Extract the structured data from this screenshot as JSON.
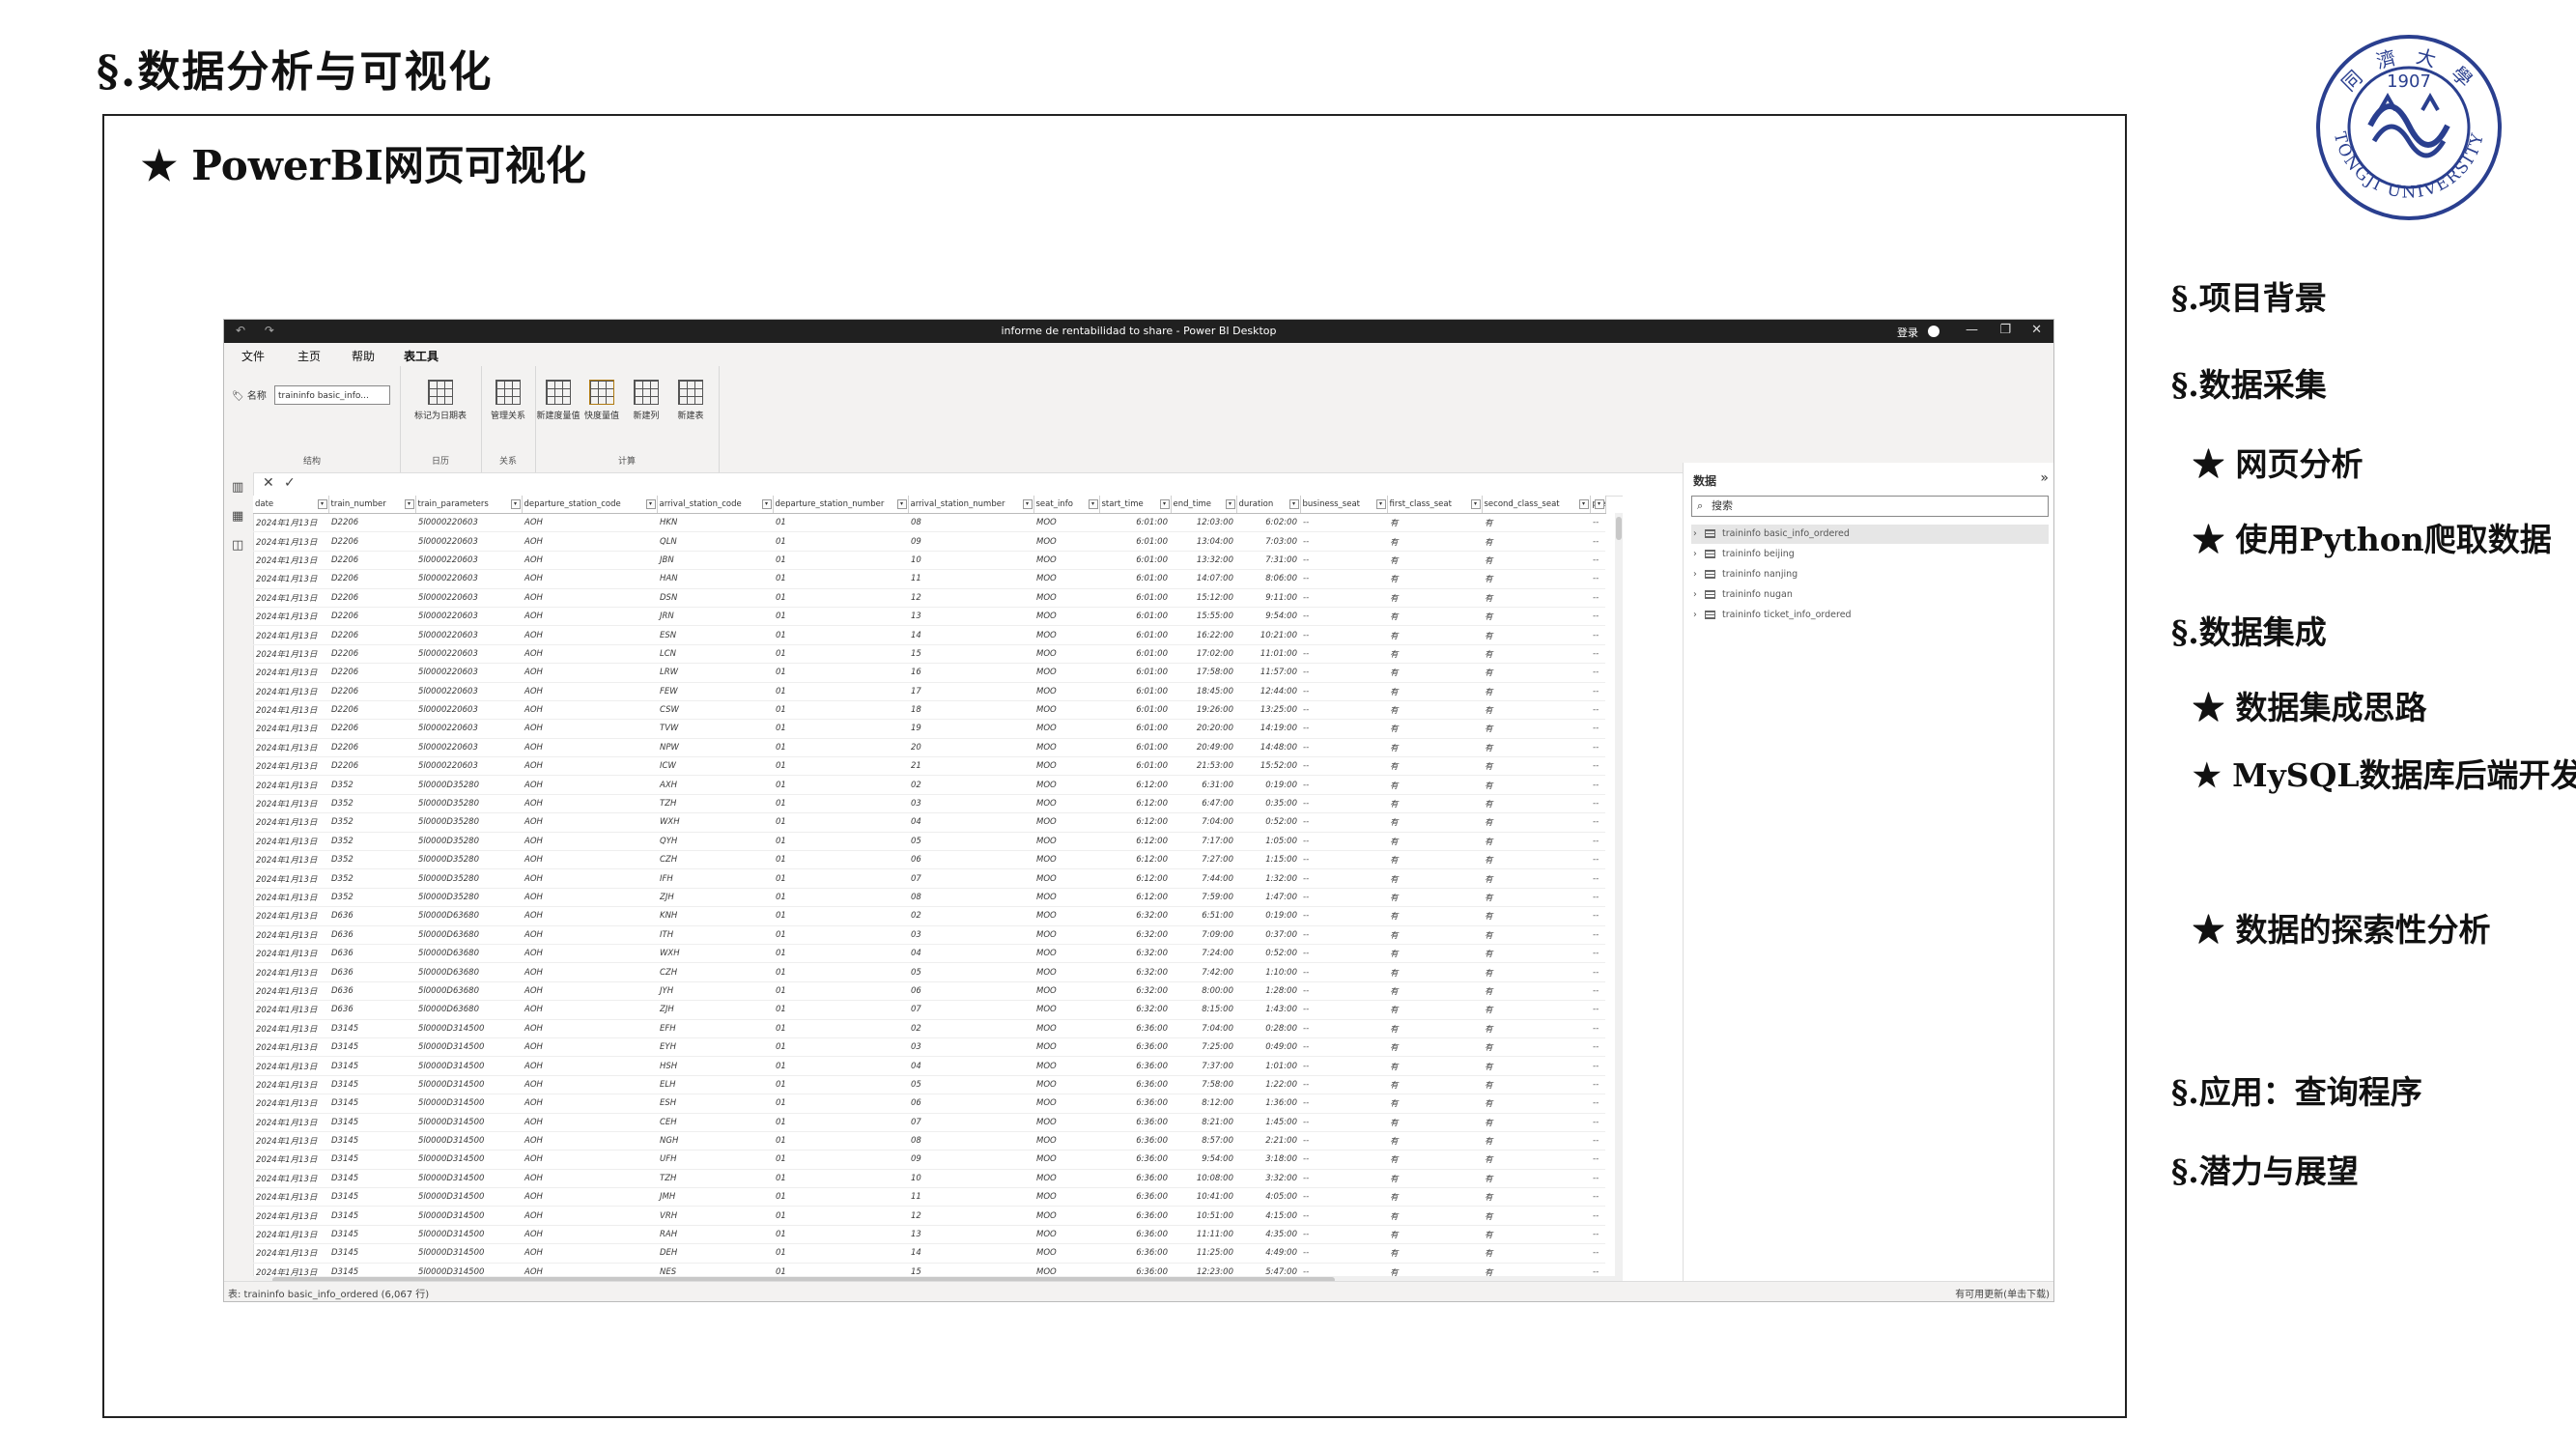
{
  "slide": {
    "title": "§.数据分析与可视化",
    "heading": "★ PowerBI网页可视化"
  },
  "nav": {
    "items": [
      {
        "label": "§.项目背景"
      },
      {
        "label": "§.数据采集"
      },
      {
        "label": "★ 网页分析"
      },
      {
        "label": "★ 使用Python爬取数据"
      },
      {
        "label": "§.数据集成"
      },
      {
        "label": "★ 数据集成思路"
      },
      {
        "label": "★ MySQL数据库后端开发"
      },
      {
        "label": "★ 数据的探索性分析"
      },
      {
        "label": "§.应用：查询程序"
      },
      {
        "label": "§.潜力与展望"
      }
    ]
  },
  "logo": {
    "year": "1907",
    "text": "TONGJI UNIVERSITY",
    "chars": "同 濟 大 學"
  },
  "powerbi": {
    "window_title": "informe de rentabilidad to share - Power BI Desktop",
    "quick_access": "↶ ↷",
    "login": "登录",
    "window_controls": {
      "min": "—",
      "max": "❐",
      "close": "✕"
    },
    "menu": [
      "文件",
      "主页",
      "帮助",
      "表工具"
    ],
    "ribbon": {
      "name_label": "名称",
      "name_value": "traininfo basic_info...",
      "group_structure": "结构",
      "mark_date_table": "标记为日期表",
      "group_calendar": "日历",
      "manage_relations": "管理关系",
      "group_relations": "关系",
      "new_measure": "新建度量值",
      "quick_measure": "快度量值",
      "new_column": "新建列",
      "new_table": "新建表",
      "group_calc": "计算"
    },
    "left_icons": [
      "bar-chart-icon",
      "table-icon",
      "model-icon"
    ],
    "formula": {
      "cancel": "✕",
      "commit": "✓"
    },
    "columns": [
      "date",
      "train_number",
      "train_parameters",
      "departure_station_code",
      "arrival_station_code",
      "departure_station_number",
      "arrival_station_number",
      "seat_info",
      "start_time",
      "end_time",
      "duration",
      "business_seat",
      "first_class_seat",
      "second_class_seat",
      "premiu"
    ],
    "rows": [
      [
        "2024年1月13日",
        "D2206",
        "5l0000220603",
        "AOH",
        "HKN",
        "01",
        "08",
        "MOO",
        "6:01:00",
        "12:03:00",
        "6:02:00",
        "--",
        "有",
        "有",
        "--"
      ],
      [
        "2024年1月13日",
        "D2206",
        "5l0000220603",
        "AOH",
        "QLN",
        "01",
        "09",
        "MOO",
        "6:01:00",
        "13:04:00",
        "7:03:00",
        "--",
        "有",
        "有",
        "--"
      ],
      [
        "2024年1月13日",
        "D2206",
        "5l0000220603",
        "AOH",
        "JBN",
        "01",
        "10",
        "MOO",
        "6:01:00",
        "13:32:00",
        "7:31:00",
        "--",
        "有",
        "有",
        "--"
      ],
      [
        "2024年1月13日",
        "D2206",
        "5l0000220603",
        "AOH",
        "HAN",
        "01",
        "11",
        "MOO",
        "6:01:00",
        "14:07:00",
        "8:06:00",
        "--",
        "有",
        "有",
        "--"
      ],
      [
        "2024年1月13日",
        "D2206",
        "5l0000220603",
        "AOH",
        "DSN",
        "01",
        "12",
        "MOO",
        "6:01:00",
        "15:12:00",
        "9:11:00",
        "--",
        "有",
        "有",
        "--"
      ],
      [
        "2024年1月13日",
        "D2206",
        "5l0000220603",
        "AOH",
        "JRN",
        "01",
        "13",
        "MOO",
        "6:01:00",
        "15:55:00",
        "9:54:00",
        "--",
        "有",
        "有",
        "--"
      ],
      [
        "2024年1月13日",
        "D2206",
        "5l0000220603",
        "AOH",
        "ESN",
        "01",
        "14",
        "MOO",
        "6:01:00",
        "16:22:00",
        "10:21:00",
        "--",
        "有",
        "有",
        "--"
      ],
      [
        "2024年1月13日",
        "D2206",
        "5l0000220603",
        "AOH",
        "LCN",
        "01",
        "15",
        "MOO",
        "6:01:00",
        "17:02:00",
        "11:01:00",
        "--",
        "有",
        "有",
        "--"
      ],
      [
        "2024年1月13日",
        "D2206",
        "5l0000220603",
        "AOH",
        "LRW",
        "01",
        "16",
        "MOO",
        "6:01:00",
        "17:58:00",
        "11:57:00",
        "--",
        "有",
        "有",
        "--"
      ],
      [
        "2024年1月13日",
        "D2206",
        "5l0000220603",
        "AOH",
        "FEW",
        "01",
        "17",
        "MOO",
        "6:01:00",
        "18:45:00",
        "12:44:00",
        "--",
        "有",
        "有",
        "--"
      ],
      [
        "2024年1月13日",
        "D2206",
        "5l0000220603",
        "AOH",
        "CSW",
        "01",
        "18",
        "MOO",
        "6:01:00",
        "19:26:00",
        "13:25:00",
        "--",
        "有",
        "有",
        "--"
      ],
      [
        "2024年1月13日",
        "D2206",
        "5l0000220603",
        "AOH",
        "TVW",
        "01",
        "19",
        "MOO",
        "6:01:00",
        "20:20:00",
        "14:19:00",
        "--",
        "有",
        "有",
        "--"
      ],
      [
        "2024年1月13日",
        "D2206",
        "5l0000220603",
        "AOH",
        "NPW",
        "01",
        "20",
        "MOO",
        "6:01:00",
        "20:49:00",
        "14:48:00",
        "--",
        "有",
        "有",
        "--"
      ],
      [
        "2024年1月13日",
        "D2206",
        "5l0000220603",
        "AOH",
        "ICW",
        "01",
        "21",
        "MOO",
        "6:01:00",
        "21:53:00",
        "15:52:00",
        "--",
        "有",
        "有",
        "--"
      ],
      [
        "2024年1月13日",
        "D352",
        "5l0000D35280",
        "AOH",
        "AXH",
        "01",
        "02",
        "MOO",
        "6:12:00",
        "6:31:00",
        "0:19:00",
        "--",
        "有",
        "有",
        "--"
      ],
      [
        "2024年1月13日",
        "D352",
        "5l0000D35280",
        "AOH",
        "TZH",
        "01",
        "03",
        "MOO",
        "6:12:00",
        "6:47:00",
        "0:35:00",
        "--",
        "有",
        "有",
        "--"
      ],
      [
        "2024年1月13日",
        "D352",
        "5l0000D35280",
        "AOH",
        "WXH",
        "01",
        "04",
        "MOO",
        "6:12:00",
        "7:04:00",
        "0:52:00",
        "--",
        "有",
        "有",
        "--"
      ],
      [
        "2024年1月13日",
        "D352",
        "5l0000D35280",
        "AOH",
        "QYH",
        "01",
        "05",
        "MOO",
        "6:12:00",
        "7:17:00",
        "1:05:00",
        "--",
        "有",
        "有",
        "--"
      ],
      [
        "2024年1月13日",
        "D352",
        "5l0000D35280",
        "AOH",
        "CZH",
        "01",
        "06",
        "MOO",
        "6:12:00",
        "7:27:00",
        "1:15:00",
        "--",
        "有",
        "有",
        "--"
      ],
      [
        "2024年1月13日",
        "D352",
        "5l0000D35280",
        "AOH",
        "IFH",
        "01",
        "07",
        "MOO",
        "6:12:00",
        "7:44:00",
        "1:32:00",
        "--",
        "有",
        "有",
        "--"
      ],
      [
        "2024年1月13日",
        "D352",
        "5l0000D35280",
        "AOH",
        "ZJH",
        "01",
        "08",
        "MOO",
        "6:12:00",
        "7:59:00",
        "1:47:00",
        "--",
        "有",
        "有",
        "--"
      ],
      [
        "2024年1月13日",
        "D636",
        "5l0000D63680",
        "AOH",
        "KNH",
        "01",
        "02",
        "MOO",
        "6:32:00",
        "6:51:00",
        "0:19:00",
        "--",
        "有",
        "有",
        "--"
      ],
      [
        "2024年1月13日",
        "D636",
        "5l0000D63680",
        "AOH",
        "ITH",
        "01",
        "03",
        "MOO",
        "6:32:00",
        "7:09:00",
        "0:37:00",
        "--",
        "有",
        "有",
        "--"
      ],
      [
        "2024年1月13日",
        "D636",
        "5l0000D63680",
        "AOH",
        "WXH",
        "01",
        "04",
        "MOO",
        "6:32:00",
        "7:24:00",
        "0:52:00",
        "--",
        "有",
        "有",
        "--"
      ],
      [
        "2024年1月13日",
        "D636",
        "5l0000D63680",
        "AOH",
        "CZH",
        "01",
        "05",
        "MOO",
        "6:32:00",
        "7:42:00",
        "1:10:00",
        "--",
        "有",
        "有",
        "--"
      ],
      [
        "2024年1月13日",
        "D636",
        "5l0000D63680",
        "AOH",
        "JYH",
        "01",
        "06",
        "MOO",
        "6:32:00",
        "8:00:00",
        "1:28:00",
        "--",
        "有",
        "有",
        "--"
      ],
      [
        "2024年1月13日",
        "D636",
        "5l0000D63680",
        "AOH",
        "ZJH",
        "01",
        "07",
        "MOO",
        "6:32:00",
        "8:15:00",
        "1:43:00",
        "--",
        "有",
        "有",
        "--"
      ],
      [
        "2024年1月13日",
        "D3145",
        "5l0000D314500",
        "AOH",
        "EFH",
        "01",
        "02",
        "MOO",
        "6:36:00",
        "7:04:00",
        "0:28:00",
        "--",
        "有",
        "有",
        "--"
      ],
      [
        "2024年1月13日",
        "D3145",
        "5l0000D314500",
        "AOH",
        "EYH",
        "01",
        "03",
        "MOO",
        "6:36:00",
        "7:25:00",
        "0:49:00",
        "--",
        "有",
        "有",
        "--"
      ],
      [
        "2024年1月13日",
        "D3145",
        "5l0000D314500",
        "AOH",
        "HSH",
        "01",
        "04",
        "MOO",
        "6:36:00",
        "7:37:00",
        "1:01:00",
        "--",
        "有",
        "有",
        "--"
      ],
      [
        "2024年1月13日",
        "D3145",
        "5l0000D314500",
        "AOH",
        "ELH",
        "01",
        "05",
        "MOO",
        "6:36:00",
        "7:58:00",
        "1:22:00",
        "--",
        "有",
        "有",
        "--"
      ],
      [
        "2024年1月13日",
        "D3145",
        "5l0000D314500",
        "AOH",
        "ESH",
        "01",
        "06",
        "MOO",
        "6:36:00",
        "8:12:00",
        "1:36:00",
        "--",
        "有",
        "有",
        "--"
      ],
      [
        "2024年1月13日",
        "D3145",
        "5l0000D314500",
        "AOH",
        "CEH",
        "01",
        "07",
        "MOO",
        "6:36:00",
        "8:21:00",
        "1:45:00",
        "--",
        "有",
        "有",
        "--"
      ],
      [
        "2024年1月13日",
        "D3145",
        "5l0000D314500",
        "AOH",
        "NGH",
        "01",
        "08",
        "MOO",
        "6:36:00",
        "8:57:00",
        "2:21:00",
        "--",
        "有",
        "有",
        "--"
      ],
      [
        "2024年1月13日",
        "D3145",
        "5l0000D314500",
        "AOH",
        "UFH",
        "01",
        "09",
        "MOO",
        "6:36:00",
        "9:54:00",
        "3:18:00",
        "--",
        "有",
        "有",
        "--"
      ],
      [
        "2024年1月13日",
        "D3145",
        "5l0000D314500",
        "AOH",
        "TZH",
        "01",
        "10",
        "MOO",
        "6:36:00",
        "10:08:00",
        "3:32:00",
        "--",
        "有",
        "有",
        "--"
      ],
      [
        "2024年1月13日",
        "D3145",
        "5l0000D314500",
        "AOH",
        "JMH",
        "01",
        "11",
        "MOO",
        "6:36:00",
        "10:41:00",
        "4:05:00",
        "--",
        "有",
        "有",
        "--"
      ],
      [
        "2024年1月13日",
        "D3145",
        "5l0000D314500",
        "AOH",
        "VRH",
        "01",
        "12",
        "MOO",
        "6:36:00",
        "10:51:00",
        "4:15:00",
        "--",
        "有",
        "有",
        "--"
      ],
      [
        "2024年1月13日",
        "D3145",
        "5l0000D314500",
        "AOH",
        "RAH",
        "01",
        "13",
        "MOO",
        "6:36:00",
        "11:11:00",
        "4:35:00",
        "--",
        "有",
        "有",
        "--"
      ],
      [
        "2024年1月13日",
        "D3145",
        "5l0000D314500",
        "AOH",
        "DEH",
        "01",
        "14",
        "MOO",
        "6:36:00",
        "11:25:00",
        "4:49:00",
        "--",
        "有",
        "有",
        "--"
      ],
      [
        "2024年1月13日",
        "D3145",
        "5l0000D314500",
        "AOH",
        "NES",
        "01",
        "15",
        "MOO",
        "6:36:00",
        "12:23:00",
        "5:47:00",
        "--",
        "有",
        "有",
        "--"
      ]
    ],
    "data_pane": {
      "title": "数据",
      "collapse": "»",
      "search_placeholder": "搜索",
      "tables": [
        "traininfo basic_info_ordered",
        "traininfo beijing",
        "traininfo nanjing",
        "traininfo nugan",
        "traininfo ticket_info_ordered"
      ]
    },
    "status_left": "表: traininfo basic_info_ordered (6,067 行)",
    "status_right": "有可用更新(单击下载)"
  }
}
